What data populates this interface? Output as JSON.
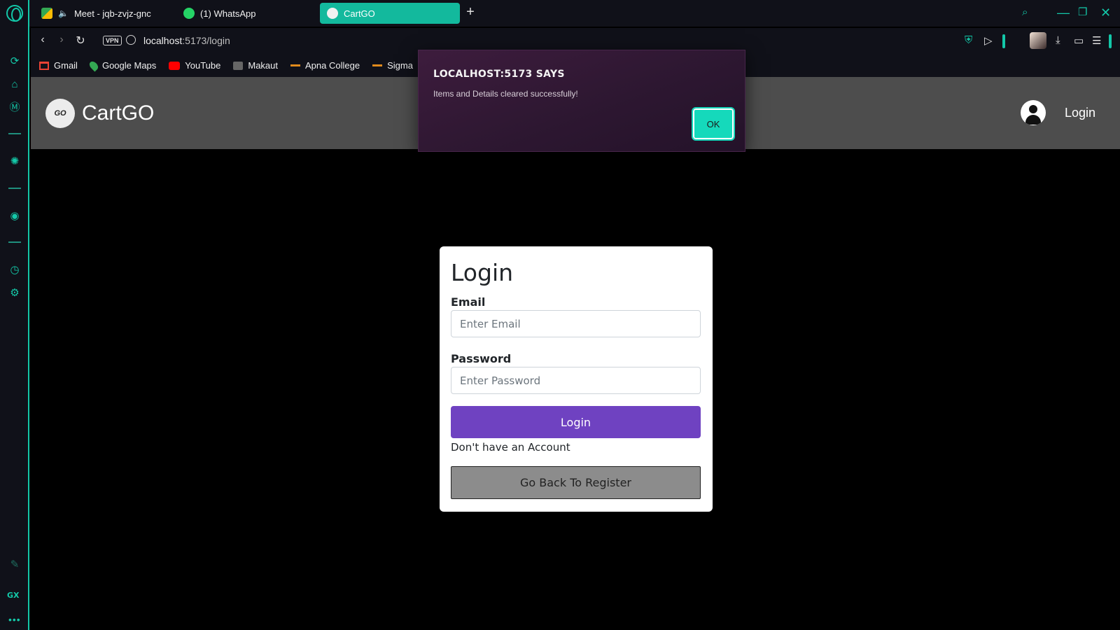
{
  "browser": {
    "tabs": [
      {
        "label": "Meet - jqb-zvjz-gnc",
        "icon": "google-meet-icon",
        "active": false
      },
      {
        "label": "(1) WhatsApp",
        "icon": "whatsapp-icon",
        "active": false
      },
      {
        "label": "CartGO",
        "icon": "cartgo-favicon-icon",
        "active": true
      }
    ],
    "url_host": "localhost",
    "url_path": ":5173/login",
    "vpn_label": "VPN",
    "bookmarks": [
      {
        "label": "Gmail",
        "icon": "gmail-icon"
      },
      {
        "label": "Google Maps",
        "icon": "google-maps-icon"
      },
      {
        "label": "YouTube",
        "icon": "youtube-icon"
      },
      {
        "label": "Makaut",
        "icon": "makaut-icon"
      },
      {
        "label": "Apna College",
        "icon": "apna-college-icon"
      },
      {
        "label": "Sigma",
        "icon": "sigma-icon"
      }
    ],
    "sidebar_gx_label": "GX",
    "accent_color": "#13c7a8"
  },
  "site": {
    "brand_name": "CartGO",
    "logo_text": "GO",
    "header_login": "Login"
  },
  "login": {
    "title": "Login",
    "email_label": "Email",
    "email_placeholder": "Enter Email",
    "email_value": "",
    "password_label": "Password",
    "password_placeholder": "Enter Password",
    "password_value": "",
    "submit_label": "Login",
    "no_account_text": "Don't have an Account",
    "register_label": "Go Back To Register",
    "submit_color": "#6f42c1"
  },
  "alert": {
    "title": "LOCALHOST:5173 SAYS",
    "message": "Items and Details cleared successfully!",
    "ok_label": "OK"
  }
}
